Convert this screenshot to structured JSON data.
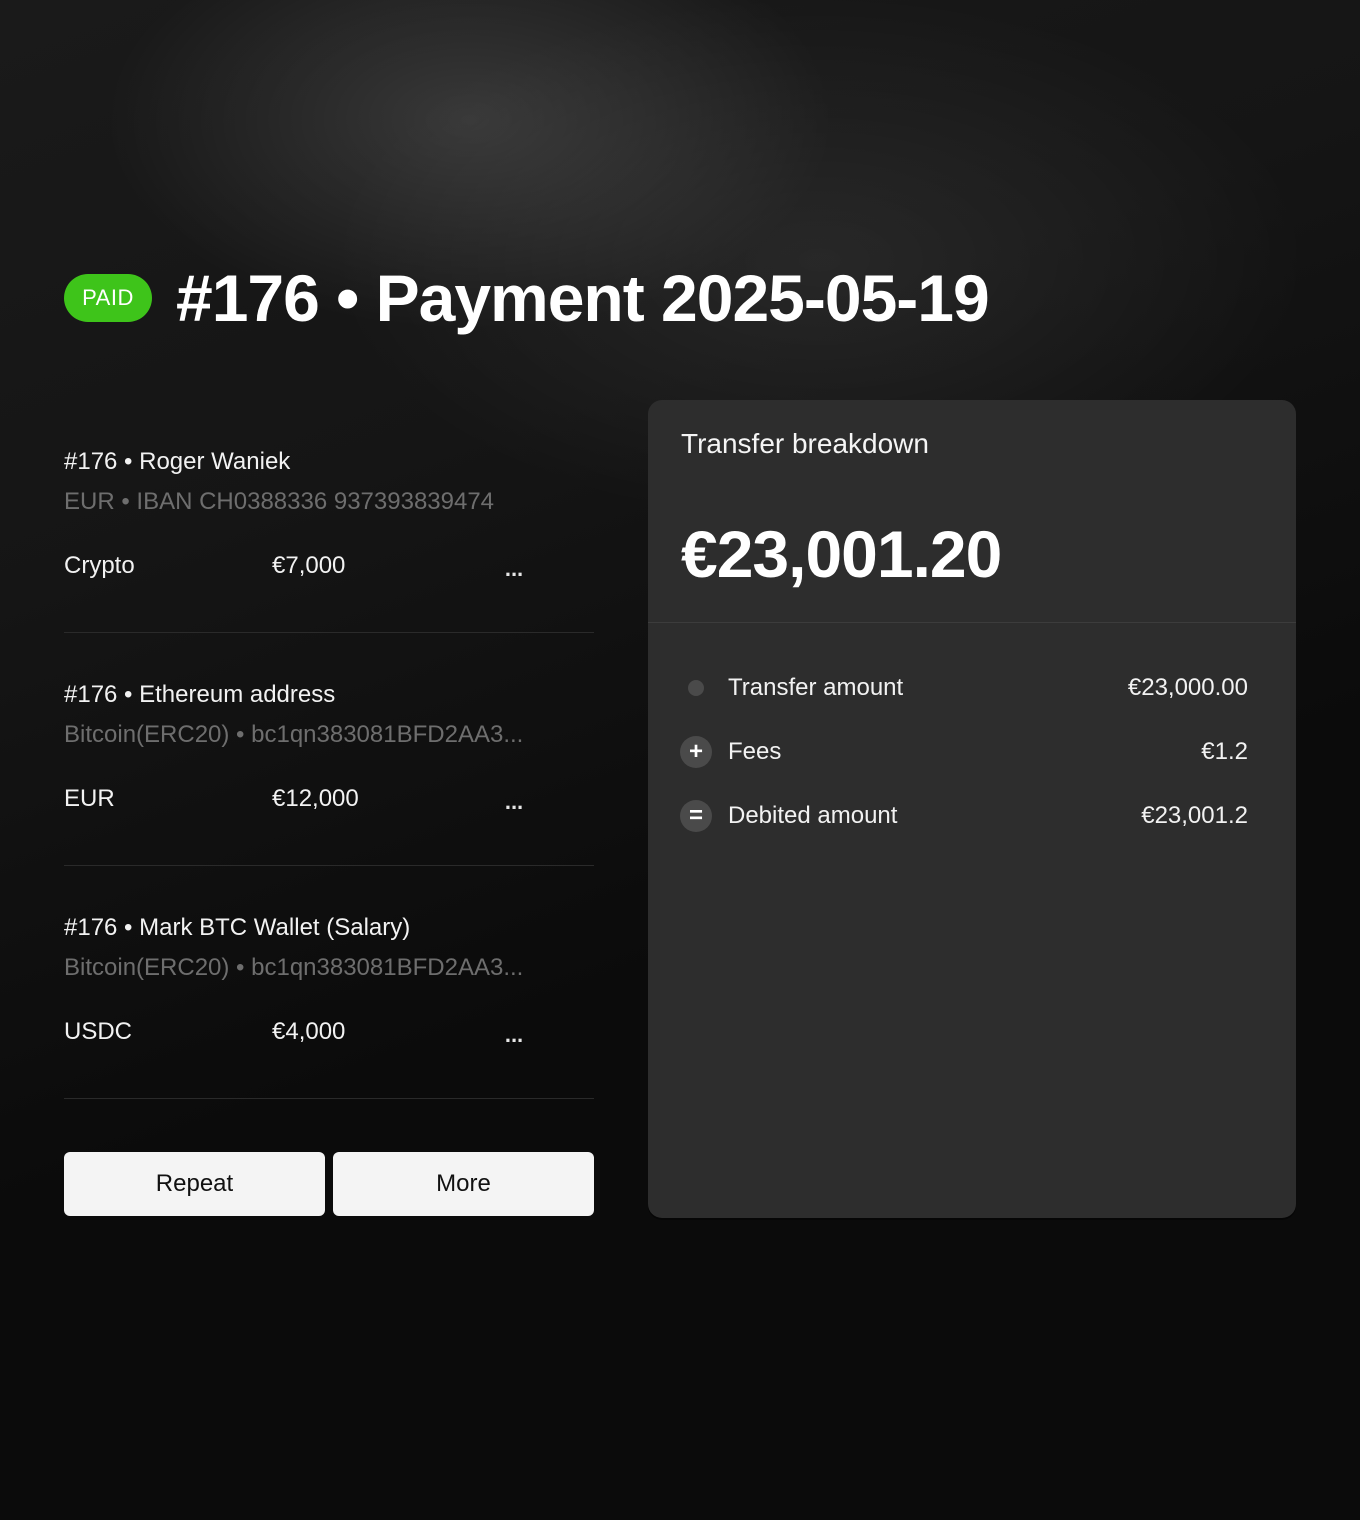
{
  "header": {
    "status": "PAID",
    "title": "#176 • Payment 2025-05-19"
  },
  "recipients": [
    {
      "title": "#176 • Roger Waniek",
      "subtitle": "EUR • IBAN CH0388336 937393839474",
      "currency": "Crypto",
      "amount": "€7,000",
      "more": "..."
    },
    {
      "title": "#176 • Ethereum address",
      "subtitle": "Bitcoin(ERC20) • bc1qn383081BFD2AA3...",
      "currency": "EUR",
      "amount": "€12,000",
      "more": "..."
    },
    {
      "title": "#176 • Mark BTC Wallet (Salary)",
      "subtitle": "Bitcoin(ERC20) • bc1qn383081BFD2AA3...",
      "currency": "USDC",
      "amount": "€4,000",
      "more": "..."
    }
  ],
  "actions": {
    "repeat_label": "Repeat",
    "more_label": "More"
  },
  "breakdown": {
    "title": "Transfer breakdown",
    "total": "€23,001.20",
    "rows": [
      {
        "icon": "dot-icon",
        "label": "Transfer amount",
        "value": "€23,000.00"
      },
      {
        "icon": "plus-icon",
        "symbol": "+",
        "label": "Fees",
        "value": "€1.2"
      },
      {
        "icon": "equals-icon",
        "symbol": "=",
        "label": "Debited amount",
        "value": "€23,001.2"
      }
    ]
  },
  "colors": {
    "background": "#0b0b0b",
    "badge": "#3ec41a",
    "panel": "#2d2d2d",
    "muted_text": "#6e6e6e",
    "button": "#f4f4f4"
  }
}
